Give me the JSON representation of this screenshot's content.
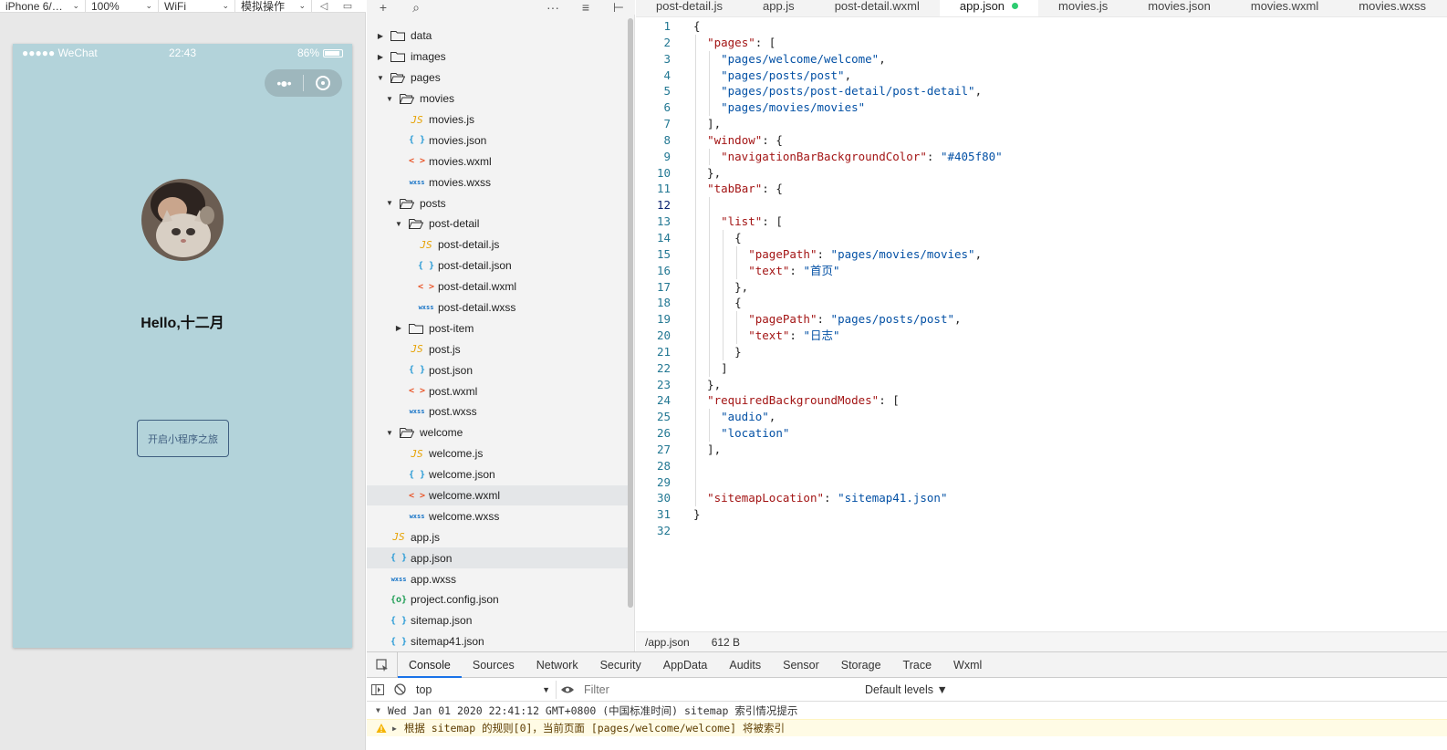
{
  "sim_toolbar": {
    "device": "iPhone 6/…",
    "zoom": "100%",
    "network": "WiFi",
    "action": "模拟操作"
  },
  "phone": {
    "carrier": "●●●●● WeChat",
    "time": "22:43",
    "battery": "86%",
    "greeting": "Hello,十二月",
    "start_button": "开启小程序之旅",
    "background": "#b3d3da",
    "accent": "#405f80"
  },
  "tree": [
    {
      "name": "data",
      "kind": "folder",
      "open": false,
      "depth": 0
    },
    {
      "name": "images",
      "kind": "folder",
      "open": false,
      "depth": 0
    },
    {
      "name": "pages",
      "kind": "folder",
      "open": true,
      "depth": 0
    },
    {
      "name": "movies",
      "kind": "folder",
      "open": true,
      "depth": 1
    },
    {
      "name": "movies.js",
      "kind": "js",
      "depth": 2
    },
    {
      "name": "movies.json",
      "kind": "json",
      "depth": 2
    },
    {
      "name": "movies.wxml",
      "kind": "wxml",
      "depth": 2
    },
    {
      "name": "movies.wxss",
      "kind": "wxss",
      "depth": 2
    },
    {
      "name": "posts",
      "kind": "folder",
      "open": true,
      "depth": 1
    },
    {
      "name": "post-detail",
      "kind": "folder",
      "open": true,
      "depth": 2
    },
    {
      "name": "post-detail.js",
      "kind": "js",
      "depth": 3
    },
    {
      "name": "post-detail.json",
      "kind": "json",
      "depth": 3
    },
    {
      "name": "post-detail.wxml",
      "kind": "wxml",
      "depth": 3
    },
    {
      "name": "post-detail.wxss",
      "kind": "wxss",
      "depth": 3
    },
    {
      "name": "post-item",
      "kind": "folder",
      "open": false,
      "depth": 2
    },
    {
      "name": "post.js",
      "kind": "js",
      "depth": 2
    },
    {
      "name": "post.json",
      "kind": "json",
      "depth": 2
    },
    {
      "name": "post.wxml",
      "kind": "wxml",
      "depth": 2
    },
    {
      "name": "post.wxss",
      "kind": "wxss",
      "depth": 2
    },
    {
      "name": "welcome",
      "kind": "folder",
      "open": true,
      "depth": 1
    },
    {
      "name": "welcome.js",
      "kind": "js",
      "depth": 2
    },
    {
      "name": "welcome.json",
      "kind": "json",
      "depth": 2
    },
    {
      "name": "welcome.wxml",
      "kind": "wxml",
      "depth": 2,
      "selected": true
    },
    {
      "name": "welcome.wxss",
      "kind": "wxss",
      "depth": 2
    },
    {
      "name": "app.js",
      "kind": "js",
      "depth": 0
    },
    {
      "name": "app.json",
      "kind": "json",
      "depth": 0,
      "selected": true
    },
    {
      "name": "app.wxss",
      "kind": "wxss",
      "depth": 0
    },
    {
      "name": "project.config.json",
      "kind": "cfg",
      "depth": 0
    },
    {
      "name": "sitemap.json",
      "kind": "json",
      "depth": 0
    },
    {
      "name": "sitemap41.json",
      "kind": "json",
      "depth": 0
    }
  ],
  "icon_glyphs": {
    "js": "JS",
    "json": "{ }",
    "wxml": "< >",
    "wxss": "wxss",
    "cfg": "{o}"
  },
  "tabs": [
    {
      "label": "post-detail.js",
      "active": false
    },
    {
      "label": "app.js",
      "active": false
    },
    {
      "label": "post-detail.wxml",
      "active": false
    },
    {
      "label": "app.json",
      "active": true,
      "modified": true
    },
    {
      "label": "movies.js",
      "active": false
    },
    {
      "label": "movies.json",
      "active": false
    },
    {
      "label": "movies.wxml",
      "active": false
    },
    {
      "label": "movies.wxss",
      "active": false
    }
  ],
  "code_lines": [
    [
      [
        "p",
        "{"
      ]
    ],
    [
      [
        "p",
        "  "
      ],
      [
        "k",
        "\"pages\""
      ],
      [
        "p",
        ": ["
      ]
    ],
    [
      [
        "p",
        "    "
      ],
      [
        "s",
        "\"pages/welcome/welcome\""
      ],
      [
        "p",
        ","
      ]
    ],
    [
      [
        "p",
        "    "
      ],
      [
        "s",
        "\"pages/posts/post\""
      ],
      [
        "p",
        ","
      ]
    ],
    [
      [
        "p",
        "    "
      ],
      [
        "s",
        "\"pages/posts/post-detail/post-detail\""
      ],
      [
        "p",
        ","
      ]
    ],
    [
      [
        "p",
        "    "
      ],
      [
        "s",
        "\"pages/movies/movies\""
      ]
    ],
    [
      [
        "p",
        "  ],"
      ]
    ],
    [
      [
        "p",
        "  "
      ],
      [
        "k",
        "\"window\""
      ],
      [
        "p",
        ": {"
      ]
    ],
    [
      [
        "p",
        "    "
      ],
      [
        "k",
        "\"navigationBarBackgroundColor\""
      ],
      [
        "p",
        ": "
      ],
      [
        "s",
        "\"#405f80\""
      ]
    ],
    [
      [
        "p",
        "  },"
      ]
    ],
    [
      [
        "p",
        "  "
      ],
      [
        "k",
        "\"tabBar\""
      ],
      [
        "p",
        ": {"
      ]
    ],
    [
      [
        "p",
        ""
      ]
    ],
    [
      [
        "p",
        "    "
      ],
      [
        "k",
        "\"list\""
      ],
      [
        "p",
        ": ["
      ]
    ],
    [
      [
        "p",
        "      {"
      ]
    ],
    [
      [
        "p",
        "        "
      ],
      [
        "k",
        "\"pagePath\""
      ],
      [
        "p",
        ": "
      ],
      [
        "s",
        "\"pages/movies/movies\""
      ],
      [
        "p",
        ","
      ]
    ],
    [
      [
        "p",
        "        "
      ],
      [
        "k",
        "\"text\""
      ],
      [
        "p",
        ": "
      ],
      [
        "s",
        "\"首页\""
      ]
    ],
    [
      [
        "p",
        "      },"
      ]
    ],
    [
      [
        "p",
        "      {"
      ]
    ],
    [
      [
        "p",
        "        "
      ],
      [
        "k",
        "\"pagePath\""
      ],
      [
        "p",
        ": "
      ],
      [
        "s",
        "\"pages/posts/post\""
      ],
      [
        "p",
        ","
      ]
    ],
    [
      [
        "p",
        "        "
      ],
      [
        "k",
        "\"text\""
      ],
      [
        "p",
        ": "
      ],
      [
        "s",
        "\"日志\""
      ]
    ],
    [
      [
        "p",
        "      }"
      ]
    ],
    [
      [
        "p",
        "    ]"
      ]
    ],
    [
      [
        "p",
        "  },"
      ]
    ],
    [
      [
        "p",
        "  "
      ],
      [
        "k",
        "\"requiredBackgroundModes\""
      ],
      [
        "p",
        ": ["
      ]
    ],
    [
      [
        "p",
        "    "
      ],
      [
        "s",
        "\"audio\""
      ],
      [
        "p",
        ","
      ]
    ],
    [
      [
        "p",
        "    "
      ],
      [
        "s",
        "\"location\""
      ]
    ],
    [
      [
        "p",
        "  ],"
      ]
    ],
    [
      [
        "p",
        ""
      ]
    ],
    [
      [
        "p",
        ""
      ]
    ],
    [
      [
        "p",
        "  "
      ],
      [
        "k",
        "\"sitemapLocation\""
      ],
      [
        "p",
        ": "
      ],
      [
        "s",
        "\"sitemap41.json\""
      ]
    ],
    [
      [
        "p",
        "}"
      ]
    ],
    [
      [
        "p",
        ""
      ]
    ]
  ],
  "current_line": 12,
  "editor_status": {
    "path": "/app.json",
    "size": "612 B"
  },
  "devtools": {
    "tabs": [
      "Console",
      "Sources",
      "Network",
      "Security",
      "AppData",
      "Audits",
      "Sensor",
      "Storage",
      "Trace",
      "Wxml"
    ],
    "active_tab": "Console",
    "context": "top",
    "filter_placeholder": "Filter",
    "levels": "Default levels ▼",
    "log_header": "Wed Jan 01 2020 22:41:12 GMT+0800 (中国标准时间) sitemap 索引情况提示",
    "warning": "根据 sitemap 的规则[0]，当前页面 [pages/welcome/welcome] 将被索引"
  }
}
